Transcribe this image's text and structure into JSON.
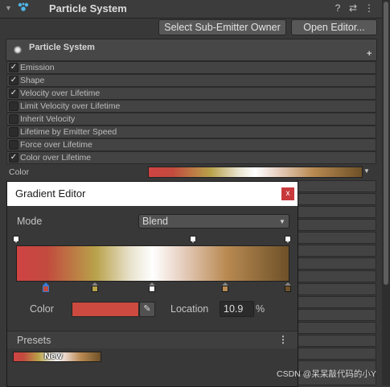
{
  "header": {
    "title": "Particle System",
    "icons": [
      "foldout-arrow-icon",
      "particle-system-icon",
      "help-icon",
      "settings-sliders-icon",
      "more-options-icon"
    ]
  },
  "toolbar": {
    "sub_emitter_label": "Select Sub-Emitter Owner",
    "open_editor_label": "Open Editor..."
  },
  "particle_system": {
    "name": "Particle System",
    "add_label": "+"
  },
  "modules": [
    {
      "label": "Emission",
      "checked": true
    },
    {
      "label": "Shape",
      "checked": true
    },
    {
      "label": "Velocity over Lifetime",
      "checked": true
    },
    {
      "label": "Limit Velocity over Lifetime",
      "checked": false
    },
    {
      "label": "Inherit Velocity",
      "checked": false
    },
    {
      "label": "Lifetime by Emitter Speed",
      "checked": false
    },
    {
      "label": "Force over Lifetime",
      "checked": false
    },
    {
      "label": "Color over Lifetime",
      "checked": true
    }
  ],
  "color_row": {
    "label": "Color"
  },
  "gradient_colors": {
    "stops": [
      "#cf4343",
      "#c24a3e",
      "#b8a24a",
      "#e9e3cf",
      "#ffffff",
      "#e8d2c4",
      "#b98a52",
      "#6e5128"
    ]
  },
  "gradient_editor": {
    "title": "Gradient Editor",
    "close_label": "x",
    "mode_label": "Mode",
    "mode_value": "Blend",
    "color_label": "Color",
    "color_value": "#cc4a3f",
    "location_label": "Location",
    "location_value": "10.9",
    "percent_label": "%",
    "presets_label": "Presets",
    "presets_menu": "⋮",
    "preset_name": "New",
    "alpha_keys": [
      0.0,
      0.65,
      1.0
    ],
    "color_keys": [
      {
        "pos": 0.109,
        "color": "#c24a3e",
        "selected": true
      },
      {
        "pos": 0.29,
        "color": "#b8a24a",
        "selected": false
      },
      {
        "pos": 0.5,
        "color": "#ffffff",
        "selected": false
      },
      {
        "pos": 0.77,
        "color": "#b98a52",
        "selected": false
      },
      {
        "pos": 1.0,
        "color": "#6e5128",
        "selected": false
      }
    ]
  },
  "watermark": "CSDN @呆呆敲代码的小Y"
}
